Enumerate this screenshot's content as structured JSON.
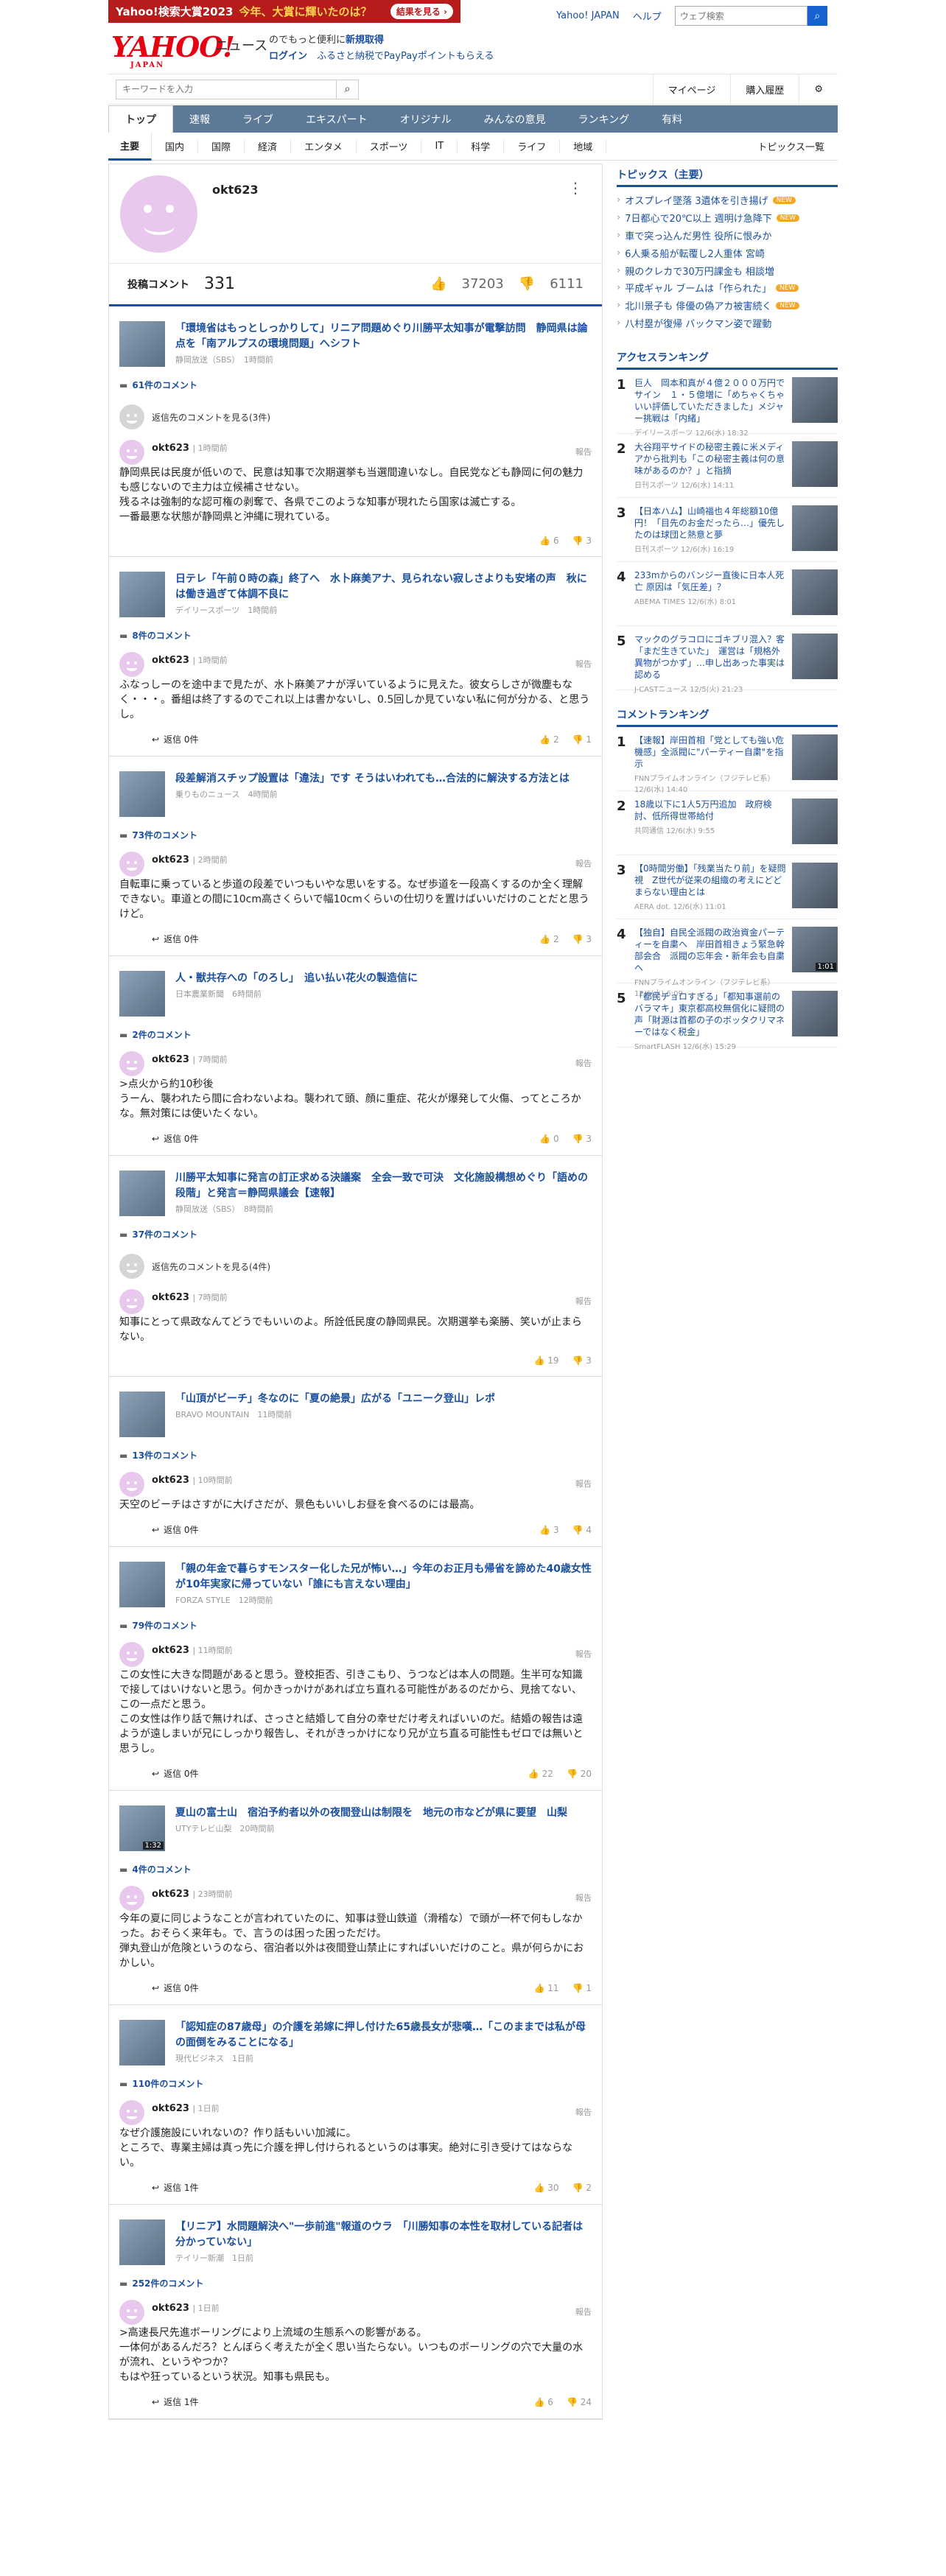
{
  "banner": {
    "brand": "Yahoo!検索大賞2023",
    "text": "今年、大賞に輝いたのは？",
    "button": "結果を見る ›"
  },
  "header": {
    "yj_link": "Yahoo! JAPAN",
    "help": "ヘルプ",
    "search_placeholder": "ウェブ検索",
    "logo": "YAHOO!",
    "logo_sub": "JAPAN",
    "service": "ニュース",
    "promo_line1_pre": "のでもっと便利に",
    "promo_line1_link": "新規取得",
    "promo_line2_link": "ログイン",
    "promo_line2_text": "ふるさと納税でPayPayポイントもらえる"
  },
  "searchbar": {
    "placeholder": "キーワードを入力",
    "mypage": "マイページ",
    "history": "購入履歴"
  },
  "nav": [
    "トップ",
    "速報",
    "ライブ",
    "エキスパート",
    "オリジナル",
    "みんなの意見",
    "ランキング",
    "有料"
  ],
  "subnav": [
    "主要",
    "国内",
    "国際",
    "経済",
    "エンタメ",
    "スポーツ",
    "IT",
    "科学",
    "ライフ",
    "地域"
  ],
  "subnav_last": "トピックス一覧",
  "profile": {
    "name": "okt623",
    "stat_label": "投稿コメント",
    "stat_count": "331",
    "likes": "37203",
    "dislikes": "6111"
  },
  "cards": [
    {
      "title": "「環境省はもっとしっかりして」リニア問題めぐり川勝平太知事が電撃訪問　静岡県は論点を「南アルプスの環境問題」へシフト",
      "source": "静岡放送（SBS）",
      "time": "1時間前",
      "ccount": "61件のコメント",
      "reply_to": "返信先のコメントを見る(3件)",
      "has_reply": true,
      "user": "okt623",
      "ctime": "1時間前",
      "report": "報告",
      "body": "静岡県民は民度が低いので、民意は知事で次期選挙も当選間違いなし。自民党なども静岡に何の魅力も感じないので主力は立候補させない。\n残るネは強制的な認可権の剥奪で、各県でこのような知事が現れたら国家は滅亡する。\n一番最悪な状態が静岡県と沖縄に現れている。",
      "replies": "",
      "up": "6",
      "down": "3"
    },
    {
      "title": "日テレ「午前０時の森」終了へ　水卜麻美アナ、見られない寂しさよりも安堵の声　秋には働き過ぎて体調不良に",
      "source": "デイリースポーツ",
      "time": "1時間前",
      "ccount": "8件のコメント",
      "has_reply": false,
      "user": "okt623",
      "ctime": "1時間前",
      "report": "報告",
      "body": "ふなっしーのを途中まで見たが、水卜麻美アナが浮いているように見えた。彼女らしさが微塵もなく・・・。番組は終了するのでこれ以上は書かないし、0.5回しか見ていない私に何が分かる、と思うし。",
      "replies": "返信 0件",
      "up": "2",
      "down": "1"
    },
    {
      "title": "段差解消スチップ設置は「違法」です そうはいわれても…合法的に解決する方法とは",
      "source": "乗りものニュース",
      "time": "4時間前",
      "ccount": "73件のコメント",
      "has_reply": false,
      "user": "okt623",
      "ctime": "2時間前",
      "report": "報告",
      "body": "自転車に乗っていると歩道の段差でいつもいやな思いをする。なぜ歩道を一段高くするのか全く理解できない。車道との間に10cm高さくらいで幅10cmくらいの仕切りを置けばいいだけのことだと思うけど。",
      "replies": "返信 0件",
      "up": "2",
      "down": "3"
    },
    {
      "title": "人・獣共存への「のろし」　追い払い花火の製造信に",
      "source": "日本農業新聞",
      "time": "6時間前",
      "ccount": "2件のコメント",
      "has_reply": false,
      "user": "okt623",
      "ctime": "7時間前",
      "report": "報告",
      "body": ">点火から約10秒後\nうーん、襲われたら間に合わないよね。襲われて頭、顔に重症、花火が爆発して火傷、ってところかな。無対策には使いたくない。",
      "replies": "返信 0件",
      "up": "0",
      "down": "3"
    },
    {
      "title": "川勝平太知事に発言の訂正求める決議案　全会一致で可決　文化施設構想めぐり「語めの段階」と発言＝静岡県議会【速報】",
      "source": "静岡放送（SBS）",
      "time": "8時間前",
      "ccount": "37件のコメント",
      "reply_to": "返信先のコメントを見る(4件)",
      "has_reply": true,
      "user": "okt623",
      "ctime": "7時間前",
      "report": "報告",
      "body": "知事にとって県政なんてどうでもいいのよ。所詮低民度の静岡県民。次期選挙も楽勝、笑いが止まらない。",
      "replies": "",
      "up": "19",
      "down": "3"
    },
    {
      "title": "「山頂がビーチ」冬なのに「夏の絶景」広がる「ユニーク登山」レポ",
      "source": "BRAVO MOUNTAIN",
      "time": "11時間前",
      "ccount": "13件のコメント",
      "has_reply": false,
      "user": "okt623",
      "ctime": "10時間前",
      "report": "報告",
      "body": "天空のビーチはさすがに大げさだが、景色もいいしお昼を食べるのには最高。",
      "replies": "返信 0件",
      "up": "3",
      "down": "4"
    },
    {
      "title": "「親の年金で暮らすモンスター化した兄が怖い…」今年のお正月も帰省を諦めた40歳女性が10年実家に帰っていない「誰にも言えない理由」",
      "source": "FORZA STYLE",
      "time": "12時間前",
      "ccount": "79件のコメント",
      "has_reply": false,
      "user": "okt623",
      "ctime": "11時間前",
      "report": "報告",
      "body": "この女性に大きな問題があると思う。登校拒否、引きこもり、うつなどは本人の問題。生半可な知識で接してはいけないと思う。何かきっかけがあれば立ち直れる可能性があるのだから、見捨てない、この一点だと思う。\nこの女性は作り話で無ければ、さっさと結婚して自分の幸せだけ考えればいいのだ。結婚の報告は遠ようが遠しまいが兄にしっかり報告し、それがきっかけになり兄が立ち直る可能性もゼロでは無いと思うし。",
      "replies": "返信 0件",
      "up": "22",
      "down": "20"
    },
    {
      "title": "夏山の富士山　宿泊予約者以外の夜間登山は制限を　地元の市などが県に要望　山梨",
      "source": "UTYテレビ山梨",
      "time": "20時間前",
      "ccount": "4件のコメント",
      "has_reply": false,
      "video": "1:32",
      "user": "okt623",
      "ctime": "23時間前",
      "report": "報告",
      "body": "今年の夏に同じようなことが言われていたのに、知事は登山鉄道（滑稽な）で頭が一杯で何もしなかった。おそらく来年も。で、言うのは困った困っただけ。\n弾丸登山が危険というのなら、宿泊者以外は夜間登山禁止にすればいいだけのこと。県が何らかにおかしい。",
      "replies": "返信 0件",
      "up": "11",
      "down": "1"
    },
    {
      "title": "「認知症の87歳母」の介護を弟嫁に押し付けた65歳長女が悲嘆…「このままでは私が母の面倒をみることになる」",
      "source": "現代ビジネス",
      "time": "1日前",
      "ccount": "110件のコメント",
      "has_reply": false,
      "user": "okt623",
      "ctime": "1日前",
      "report": "報告",
      "body": "なぜ介護施設にいれないの？作り話もいい加減に。\nところで、専業主婦は真っ先に介護を押し付けられるというのは事実。絶対に引き受けてはならない。",
      "replies": "返信 1件",
      "up": "30",
      "down": "2"
    },
    {
      "title": "【リニア】水問題解決へ\"一歩前進\"報道のウラ　「川勝知事の本性を取材している記者は分かっていない」",
      "source": "テイリー新潮",
      "time": "1日前",
      "ccount": "252件のコメント",
      "has_reply": false,
      "user": "okt623",
      "ctime": "1日前",
      "report": "報告",
      "body": ">高速長尺先進ボーリングにより上流域の生態系への影響がある。\n一体何があるんだろ？とんぼらく考えたが全く思い当たらない。いつものボーリングの穴で大量の水が流れ、というやつか？\nもはや狂っているという状況。知事も県民も。",
      "replies": "返信 1件",
      "up": "6",
      "down": "24"
    }
  ],
  "topics": {
    "heading": "トピックス（主要）",
    "items": [
      {
        "t": "オスプレイ墜落 3遺体を引き揚げ",
        "new": true
      },
      {
        "t": "7日都心で20℃以上 週明け急降下",
        "new": true
      },
      {
        "t": "車で突っ込んだ男性 役所に恨みか",
        "new": false
      },
      {
        "t": "6人乗る船が転覆し2人重体 宮崎",
        "new": false
      },
      {
        "t": "親のクレカで30万円課金も 相談増",
        "new": false
      },
      {
        "t": "平成ギャル ブームは「作られた」",
        "new": true
      },
      {
        "t": "北川景子も 俳優の偽アカ被害続く",
        "new": true
      },
      {
        "t": "八村塁が復帰 バックマン姿で躍動",
        "new": false
      }
    ],
    "new_label": "NEW"
  },
  "access": {
    "heading": "アクセスランキング",
    "items": [
      {
        "t": "巨人　岡本和真が４億２０００万円でサイン　１・５億増に「めちゃくちゃいい評価していただきました」メジャー挑戦は「内緒」",
        "s": "デイリースポーツ 12/6(水) 18:32"
      },
      {
        "t": "大谷翔平サイドの秘密主義に米メディアから批判も「この秘密主義は何の意味があるのか？」と指摘",
        "s": "日刊スポーツ 12/6(水) 14:11"
      },
      {
        "t": "【日本ハム】山崎福也４年総額10億円！「目先のお金だったら…」優先したのは球団と熱意と夢",
        "s": "日刊スポーツ 12/6(水) 16:19"
      },
      {
        "t": "233mからのバンジー直後に日本人死亡 原因は「気圧差」？",
        "s": "ABEMA TIMES 12/6(水) 8:01"
      },
      {
        "t": "マックのグラコロにゴキブリ混入？客「まだ生きていた」　運営は「規格外異物がつかず」…申し出あった事実は認める",
        "s": "J-CASTニュース 12/5(火) 21:23"
      }
    ]
  },
  "comment_rank": {
    "heading": "コメントランキング",
    "items": [
      {
        "t": "【速報】岸田首相「党としても強い危機感」全派閥に\"パーティー自粛\"を指示",
        "s": "FNNプライムオンライン（フジテレビ系） 12/6(水) 14:40"
      },
      {
        "t": "18歳以下に1人5万円追加　政府検討、低所得世帯給付",
        "s": "共同通信 12/6(水) 9:55"
      },
      {
        "t": "【0時間労働】「残業当たり前」を疑問視　Z世代が従来の組織の考えにどどまらない理由とは",
        "s": "AERA dot. 12/6(水) 11:01"
      },
      {
        "t": "【独自】自民全派閥の政治資金パーティーを自粛へ　岸田首相きょう緊急幹部会合　派閥の忘年会・新年会も自粛へ",
        "s": "FNNプライムオンライン（フジテレビ系） 12/6(水) 6:09",
        "video": "1:01"
      },
      {
        "t": "「都民チョロすぎる」「都知事選前のバラマキ」東京都高校無償化に疑問の声「財源は首都の子のボッタクリマネーではなく税金」",
        "s": "SmartFLASH 12/6(水) 15:29"
      }
    ]
  },
  "colors": {
    "accent": "#1a4fa0",
    "nav": "#5c7a97",
    "logo": "#e60012",
    "avatar": "#e8c8ec"
  }
}
